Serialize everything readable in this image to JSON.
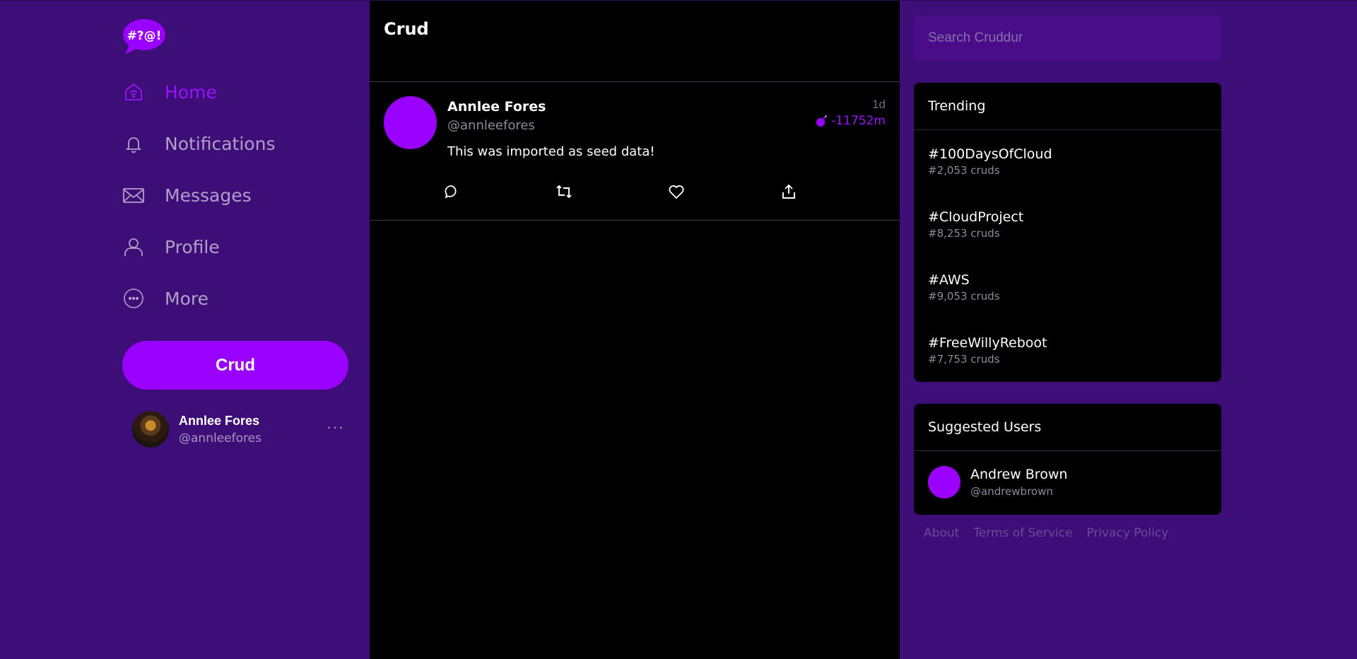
{
  "logo": {
    "text": "#?@!"
  },
  "nav": {
    "items": [
      {
        "label": "Home",
        "icon": "home-icon",
        "active": true
      },
      {
        "label": "Notifications",
        "icon": "bell-icon"
      },
      {
        "label": "Messages",
        "icon": "envelope-icon"
      },
      {
        "label": "Profile",
        "icon": "user-icon"
      },
      {
        "label": "More",
        "icon": "more-circle-icon"
      }
    ]
  },
  "crud_button": {
    "label": "Crud"
  },
  "account": {
    "name": "Annlee Fores",
    "handle": "@annleefores",
    "more": "···"
  },
  "main": {
    "title": "Crud",
    "posts": [
      {
        "name": "Annlee Fores",
        "handle": "@annleefores",
        "time": "1d",
        "expiry": "-11752m",
        "text": "This was imported as seed data!"
      }
    ]
  },
  "search": {
    "placeholder": "Search Cruddur"
  },
  "trending": {
    "title": "Trending",
    "items": [
      {
        "tag": "#100DaysOfCloud",
        "count": "#2,053 cruds"
      },
      {
        "tag": "#CloudProject",
        "count": "#8,253 cruds"
      },
      {
        "tag": "#AWS",
        "count": "#9,053 cruds"
      },
      {
        "tag": "#FreeWillyReboot",
        "count": "#7,753 cruds"
      }
    ]
  },
  "suggested": {
    "title": "Suggested Users",
    "users": [
      {
        "name": "Andrew Brown",
        "handle": "@andrewbrown"
      }
    ]
  },
  "footer": {
    "links": [
      "About",
      "Terms of Service",
      "Privacy Policy"
    ]
  },
  "colors": {
    "accent": "#9a00ff",
    "background": "#3d0d78",
    "panel": "#000000"
  }
}
